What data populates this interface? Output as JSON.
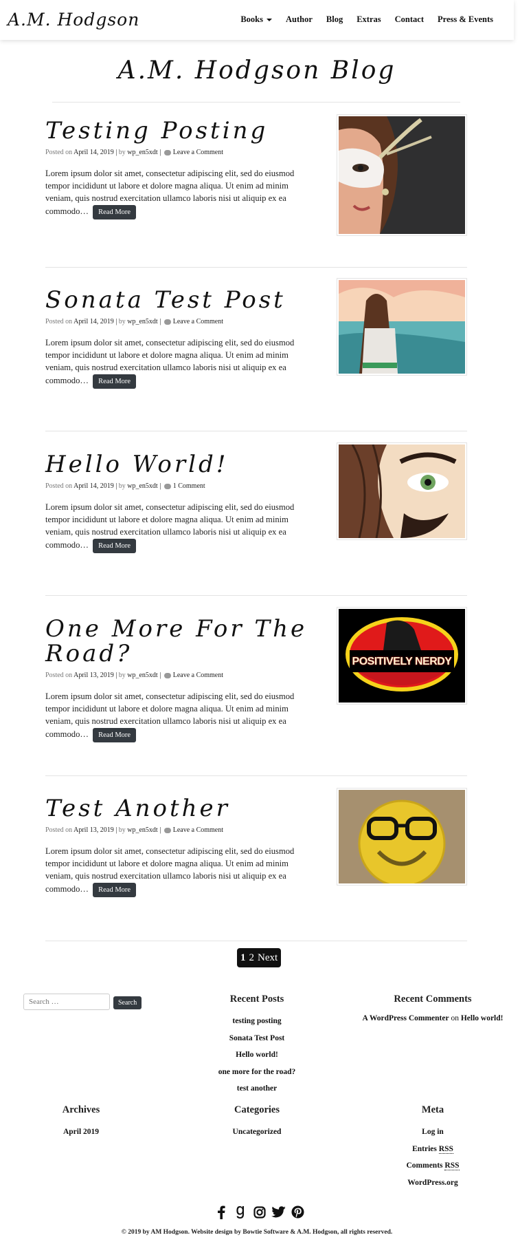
{
  "nav": {
    "brand": "A.M. Hodgson",
    "items": [
      {
        "label": "Books",
        "has_dropdown": true
      },
      {
        "label": "Author"
      },
      {
        "label": "Blog"
      },
      {
        "label": "Extras"
      },
      {
        "label": "Contact"
      },
      {
        "label": "Press & Events"
      }
    ]
  },
  "page_title": "A.M. Hodgson Blog",
  "posts": [
    {
      "title": "Testing Posting",
      "posted_on_label": "Posted on",
      "date": "April 14, 2019",
      "by_label": "by",
      "author": "wp_en5xdt",
      "comments": "Leave a Comment",
      "excerpt": "Lorem ipsum dolor sit amet, consectetur adipiscing elit, sed do eiusmod tempor incididunt ut labore et dolore magna aliqua. Ut enim ad minim veniam, quis nostrud exercitation ullamco laboris nisi ut aliquip ex ea commodo…",
      "read_more": "Read More",
      "image_icon": "masked-woman-illustration"
    },
    {
      "title": "Sonata Test Post",
      "posted_on_label": "Posted on",
      "date": "April 14, 2019",
      "by_label": "by",
      "author": "wp_en5xdt",
      "comments": "Leave a Comment",
      "excerpt": "Lorem ipsum dolor sit amet, consectetur adipiscing elit, sed do eiusmod tempor incididunt ut labore et dolore magna aliqua. Ut enim ad minim veniam, quis nostrud exercitation ullamco laboris nisi ut aliquip ex ea commodo…",
      "read_more": "Read More",
      "image_icon": "woman-at-sunset-illustration"
    },
    {
      "title": "Hello World!",
      "posted_on_label": "Posted on",
      "date": "April 14, 2019",
      "by_label": "by",
      "author": "wp_en5xdt",
      "comments": "1 Comment",
      "excerpt": "Lorem ipsum dolor sit amet, consectetur adipiscing elit, sed do eiusmod tempor incididunt ut labore et dolore magna aliqua. Ut enim ad minim veniam, quis nostrud exercitation ullamco laboris nisi ut aliquip ex ea commodo…",
      "read_more": "Read More",
      "image_icon": "eye-closeup-illustration"
    },
    {
      "title": "One More For The Road?",
      "posted_on_label": "Posted on",
      "date": "April 13, 2019",
      "by_label": "by",
      "author": "wp_en5xdt",
      "comments": "Leave a Comment",
      "excerpt": "Lorem ipsum dolor sit amet, consectetur adipiscing elit, sed do eiusmod tempor incididunt ut labore et dolore magna aliqua. Ut enim ad minim veniam, quis nostrud exercitation ullamco laboris nisi ut aliquip ex ea commodo…",
      "read_more": "Read More",
      "image_icon": "positively-nerdy-logo",
      "image_text": "POSITIVELY NERDY"
    },
    {
      "title": "Test Another",
      "posted_on_label": "Posted on",
      "date": "April 13, 2019",
      "by_label": "by",
      "author": "wp_en5xdt",
      "comments": "Leave a Comment",
      "excerpt": "Lorem ipsum dolor sit amet, consectetur adipiscing elit, sed do eiusmod tempor incididunt ut labore et dolore magna aliqua. Ut enim ad minim veniam, quis nostrud exercitation ullamco laboris nisi ut aliquip ex ea commodo…",
      "read_more": "Read More",
      "image_icon": "smiley-with-glasses-photo"
    }
  ],
  "pagination": {
    "current": "1",
    "page2": "2",
    "next": "Next"
  },
  "search": {
    "placeholder": "Search …",
    "button": "Search"
  },
  "recent_posts": {
    "title": "Recent Posts",
    "items": [
      "testing posting",
      "Sonata Test Post",
      "Hello world!",
      "one more for the road?",
      "test another"
    ]
  },
  "recent_comments": {
    "title": "Recent Comments",
    "author": "A WordPress Commenter",
    "on": "on",
    "post": "Hello world!"
  },
  "archives": {
    "title": "Archives",
    "items": [
      "April 2019"
    ]
  },
  "categories": {
    "title": "Categories",
    "items": [
      "Uncategorized"
    ]
  },
  "meta": {
    "title": "Meta",
    "login": "Log in",
    "entries_prefix": "Entries",
    "comments_prefix": "Comments",
    "rss": "RSS",
    "wordpress": "WordPress.org"
  },
  "social_icons": [
    "facebook-icon",
    "goodreads-icon",
    "instagram-icon",
    "twitter-icon",
    "pinterest-icon"
  ],
  "footer": {
    "copyright": "© 2019 by AM Hodgson. Website design by Bowtie Software & A.M. Hodgson, all rights reserved."
  },
  "colors": {
    "button_dark": "#343a40",
    "logo_red": "#e01a1a",
    "logo_yellow": "#f6d21b"
  }
}
